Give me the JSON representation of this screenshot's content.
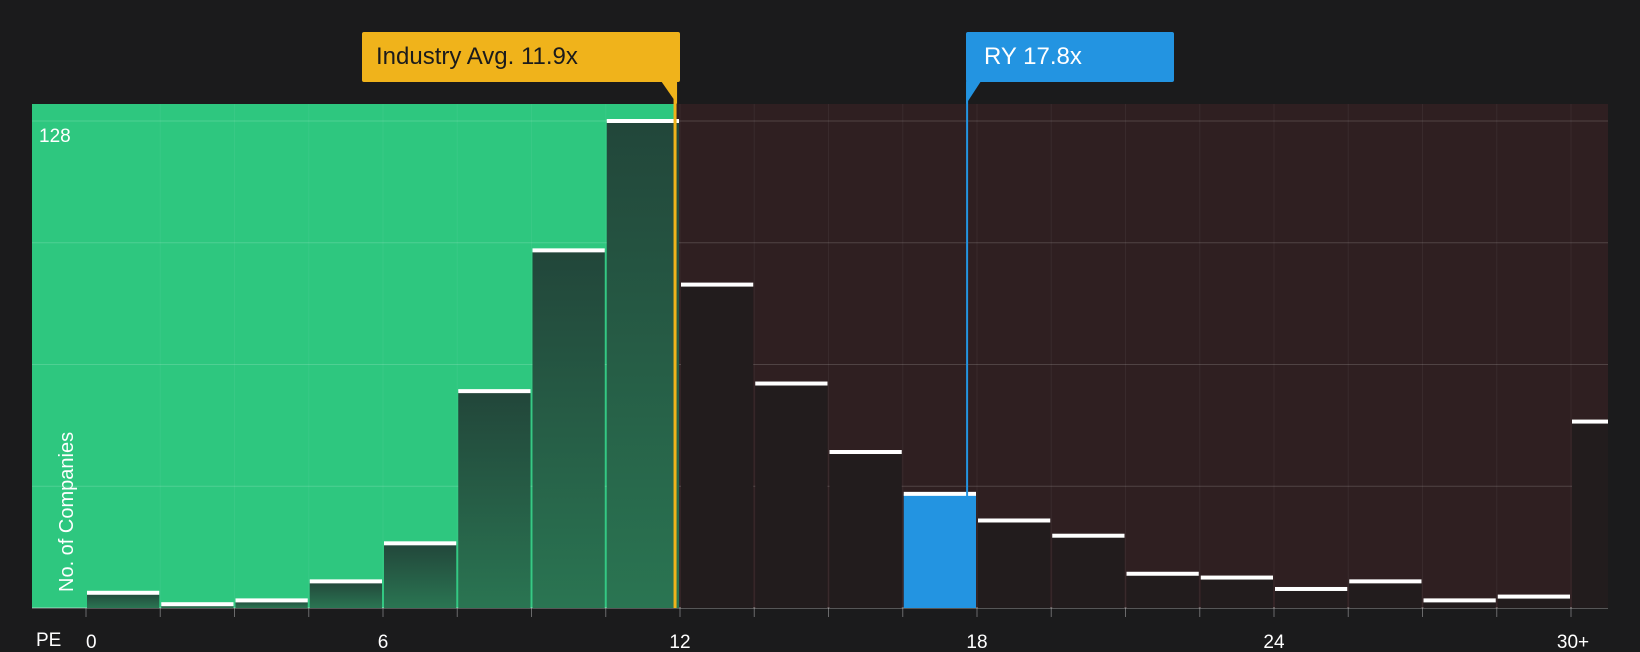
{
  "chart_data": {
    "type": "bar",
    "title": "",
    "xlabel": "PE",
    "ylabel": "No. of Companies",
    "y_max_label": "128",
    "ylim": [
      0,
      128
    ],
    "x_ticks": [
      "0",
      "6",
      "12",
      "18",
      "24",
      "30+"
    ],
    "x_tick_values": [
      0,
      6,
      12,
      18,
      24,
      30
    ],
    "bin_width": 1.5,
    "bins": [
      {
        "x_start": 0,
        "value": 4
      },
      {
        "x_start": 1.5,
        "value": 1
      },
      {
        "x_start": 3,
        "value": 2
      },
      {
        "x_start": 4.5,
        "value": 7
      },
      {
        "x_start": 6,
        "value": 17
      },
      {
        "x_start": 7.5,
        "value": 57
      },
      {
        "x_start": 9,
        "value": 94
      },
      {
        "x_start": 10.5,
        "value": 128
      },
      {
        "x_start": 12,
        "value": 85
      },
      {
        "x_start": 13.5,
        "value": 59
      },
      {
        "x_start": 15,
        "value": 41
      },
      {
        "x_start": 16.5,
        "value": 30
      },
      {
        "x_start": 18,
        "value": 23
      },
      {
        "x_start": 19.5,
        "value": 19
      },
      {
        "x_start": 21,
        "value": 9
      },
      {
        "x_start": 22.5,
        "value": 8
      },
      {
        "x_start": 24,
        "value": 5
      },
      {
        "x_start": 25.5,
        "value": 7
      },
      {
        "x_start": 27,
        "value": 2
      },
      {
        "x_start": 28.5,
        "value": 3
      },
      {
        "x_start": 30,
        "value": 49
      }
    ],
    "industry_avg": {
      "label": "Industry Avg. 11.9x",
      "value": 11.9
    },
    "company": {
      "label": "RY 17.8x",
      "value": 17.8
    },
    "grid": true
  },
  "colors": {
    "background": "#1b1b1c",
    "undervalued_zone": "#2ec77f",
    "overvalued_zone": "#2f1f21",
    "industry_marker": "#f0b31b",
    "company_marker": "#2394e1",
    "bar_top": "#ffffff"
  }
}
